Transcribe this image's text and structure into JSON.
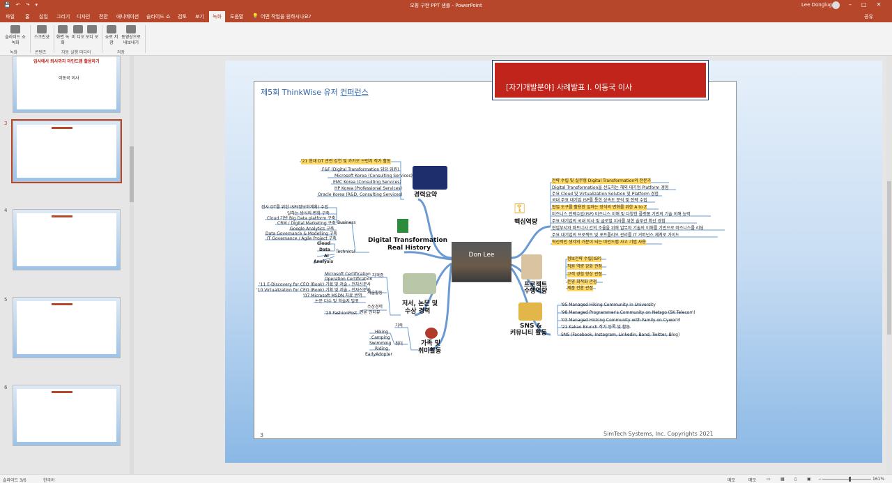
{
  "titlebar": {
    "title": "오핑 구현 PPT 샘플 - PowerPoint",
    "user": "Lee Donglug",
    "qa": [
      "💾",
      "↶",
      "↷",
      "▾"
    ]
  },
  "tabs": [
    "파일",
    "홈",
    "삽입",
    "그리기",
    "디자인",
    "전환",
    "애니메이션",
    "슬라이드 쇼",
    "검토",
    "보기",
    "녹화",
    "도움말",
    "어떤 작업을 원하시나요?"
  ],
  "share": "공유",
  "ribbon": {
    "buttons": [
      "슬라이드 쇼 녹화",
      "스크린샷",
      "화면 녹화",
      "비 디오",
      "오디 오",
      "쇼로 저장",
      "동영상으로 내보내기"
    ],
    "groups": [
      "녹화",
      "콘텐츠",
      "자동 실행 미디어",
      "저장"
    ]
  },
  "thumbs": {
    "numbers": [
      "3",
      "4",
      "5",
      "6"
    ],
    "first_title": "입사에서 퇴사까지 마인드맵 활용하기",
    "first_name": "이동국 이사"
  },
  "slide": {
    "banner": "[자기개발분야]  사례발표 I.  이동국 이사",
    "title_a": "제5회 ThinkWise 유저 ",
    "title_b": "컨퍼런스",
    "center": "Don Lee",
    "page": "3",
    "copyright": "SimTech Systems, Inc. Copyrights 2021",
    "career": {
      "label": "경력요약",
      "items": [
        "'21 현재 DT 관련 강연 및 카카오 브런치 작가 활동",
        "F&F (Digital Transformation 담당 임원)",
        "Microsoft Korea (Consulting Services)",
        "EMC Korea (Consulting Services)",
        "HP Korea (Professional Services)",
        "Oracle Korea (R&D, Consulting Services)"
      ]
    },
    "dt": {
      "label1": "Digital Transformation",
      "label2": "Real History",
      "business": "Business",
      "technical": "Technical",
      "biz_items": [
        "전사 DT를 위한 ISP(정보화계획) 수립",
        "일하는 방식의 변화 구축",
        "Cloud 기반 Big Data platform 구축",
        "CRM / Digital Marketing 구축",
        "Google Analytics 구축",
        "Data Governance & Modelling 구축",
        "IT Governance / Agile Project 구축"
      ],
      "tech_items": [
        "Cloud",
        "Data",
        "AI",
        "Analysis"
      ]
    },
    "books": {
      "label1": "저서, 논문 및",
      "label2": "수상 경력",
      "cert": "자격증",
      "cert_items": [
        "Microsoft Certification",
        "Operation Certification"
      ],
      "write": "저술활동",
      "write_items": [
        "'11 E-Discovery for CEO (Book) 기획 및 저술 - 전자신문사",
        "'10 Virtualization for CEO (Book) 기획 및 저술 - 전자신문사",
        "'07 Microsoft MSDN 자료 번역",
        "논문 다수 및 학술지 발표"
      ],
      "award": "수상경력",
      "interview": "언론 인터뷰",
      "award_item": "'20 FashionPost"
    },
    "family": {
      "label1": "가족 및",
      "label2": "취미활동",
      "fam": "가족",
      "hobby": "취미",
      "hobby_items": [
        "Hiking",
        "Camping",
        "Swimming",
        "Riding",
        "EarlyAdopter"
      ]
    },
    "core": {
      "label": "핵심역량",
      "items": [
        "전략 수립 및 실무형 Digital Transformation의 전문가",
        "Digital Transformation을 선도하는 해외 대기업 Platform 경험",
        "주요 Cloud 및 Virtualization Solution 및 Platform 경험",
        "국내 주요 대기업 ISP를 통한 상속도 분석 및 전략 수립",
        "협업 도구를 활용한 일하는 방식의 변화를 위한 A to Z",
        "비즈니스 전략수립(ISP) 비즈니스 이해 및 다양한 플랫폼 기반의 기술 이해 능력",
        "주요 대기업의 국내 지사 및 글로벌 지사를 위한 솔루션 확산 경험",
        "현업부서와 파트너사 간의 조율을 위해 업무와 기술의 이해를 기반으로 비즈니스를 리딩",
        "주요 대기업의 프로젝트 및 포트폴리오 관리를 IT 거버넌스 체계로 가이드",
        "혁신적인 생각의 거분이 되는 마인드맵 사고 기법 사용"
      ]
    },
    "project": {
      "label1": "프로젝트",
      "label2": "수행역량",
      "items": [
        "정보전략 수립(ISP)",
        "직원 역량 강화 관점",
        "고객 경험 향상 관점",
        "운영 최적화 관점",
        "제품 전환 관점"
      ]
    },
    "sns": {
      "label1": "SNS &",
      "label2": "커뮤니티 활동",
      "items": [
        "'95 Managed Hiking Community in University",
        "'98 Managed Programmer's Community on Netsgo (SK Telecom)",
        "'03 Managed Hicking Community with Family on Cyworld",
        "'21 Kakao Brunch 작가 등록 및 활동",
        "SNS (Facebook, Instagram, Linkedin, Band, Twitter, Blog)"
      ]
    }
  },
  "status": {
    "slide": "슬라이드 3/6",
    "lang": "한국어",
    "memo": "메모",
    "comment": "메모",
    "zoom": "161%"
  },
  "colors": {
    "accent": "#b7472a",
    "banner": "#c0241b",
    "branch": "#6a9ad1",
    "highlight": "#ffd966"
  }
}
